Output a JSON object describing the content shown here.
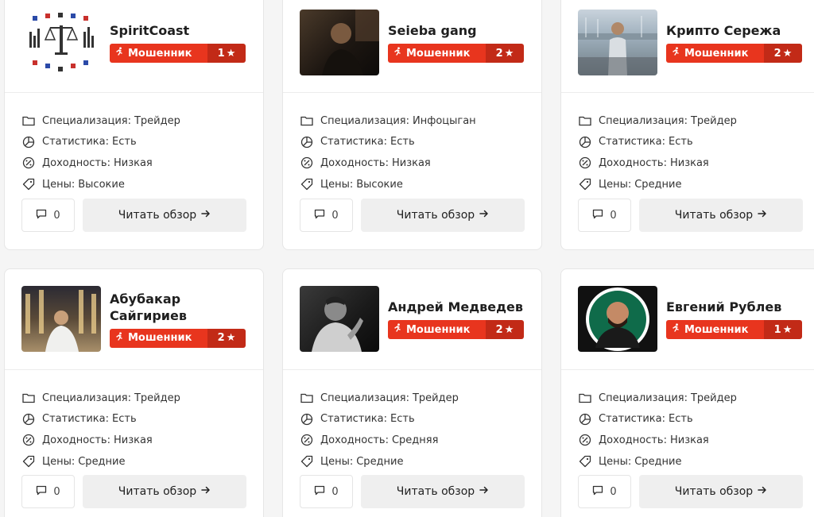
{
  "labels": {
    "specialization": "Специализация:",
    "statistics": "Статистика:",
    "yield": "Доходность:",
    "prices": "Цены:",
    "read_review": "Читать обзор",
    "badge": "Мошенник"
  },
  "cards": [
    {
      "name": "SpiritCoast",
      "rating": "1",
      "specialization": "Трейдер",
      "statistics": "Есть",
      "yield": "Низкая",
      "prices": "Высокие",
      "comments": "0"
    },
    {
      "name": "Seieba gang",
      "rating": "2",
      "specialization": "Инфоцыган",
      "statistics": "Есть",
      "yield": "Низкая",
      "prices": "Высокие",
      "comments": "0"
    },
    {
      "name": "Крипто Сережа",
      "rating": "2",
      "specialization": "Трейдер",
      "statistics": "Есть",
      "yield": "Низкая",
      "prices": "Средние",
      "comments": "0"
    },
    {
      "name": "Абубакар Сайгириев",
      "rating": "2",
      "specialization": "Трейдер",
      "statistics": "Есть",
      "yield": "Низкая",
      "prices": "Средние",
      "comments": "0"
    },
    {
      "name": "Андрей Медведев",
      "rating": "2",
      "specialization": "Трейдер",
      "statistics": "Есть",
      "yield": "Средняя",
      "prices": "Средние",
      "comments": "0"
    },
    {
      "name": "Евгений Рублев",
      "rating": "1",
      "specialization": "Трейдер",
      "statistics": "Есть",
      "yield": "Низкая",
      "prices": "Средние",
      "comments": "0"
    }
  ],
  "colors": {
    "badge": "#e8351e",
    "badge_dark": "#c22a17"
  },
  "icons": [
    "folder-icon",
    "chart-icon",
    "percent-icon",
    "tag-icon",
    "comment-icon",
    "arrow-right-icon",
    "runner-icon",
    "star-icon"
  ]
}
